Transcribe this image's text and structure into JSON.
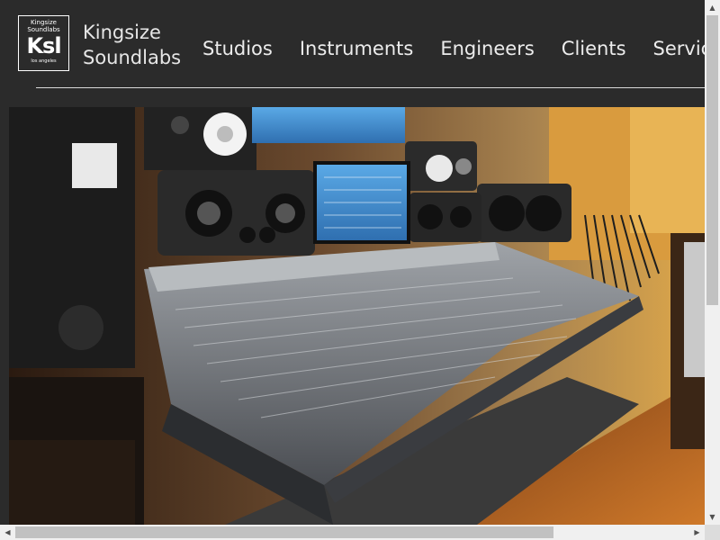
{
  "brand": {
    "logo_top": "Kingsize Soundlabs",
    "logo_mark": "Ksl",
    "logo_bottom": "los angeles",
    "name_line1": "Kingsize",
    "name_line2": "Soundlabs"
  },
  "nav": {
    "items": [
      "Studios",
      "Instruments",
      "Engineers",
      "Clients",
      "Services"
    ]
  },
  "hero": {
    "icon": "studio-console-photo"
  },
  "scrollbars": {
    "up": "▲",
    "down": "▼",
    "left": "◀",
    "right": "▶"
  }
}
